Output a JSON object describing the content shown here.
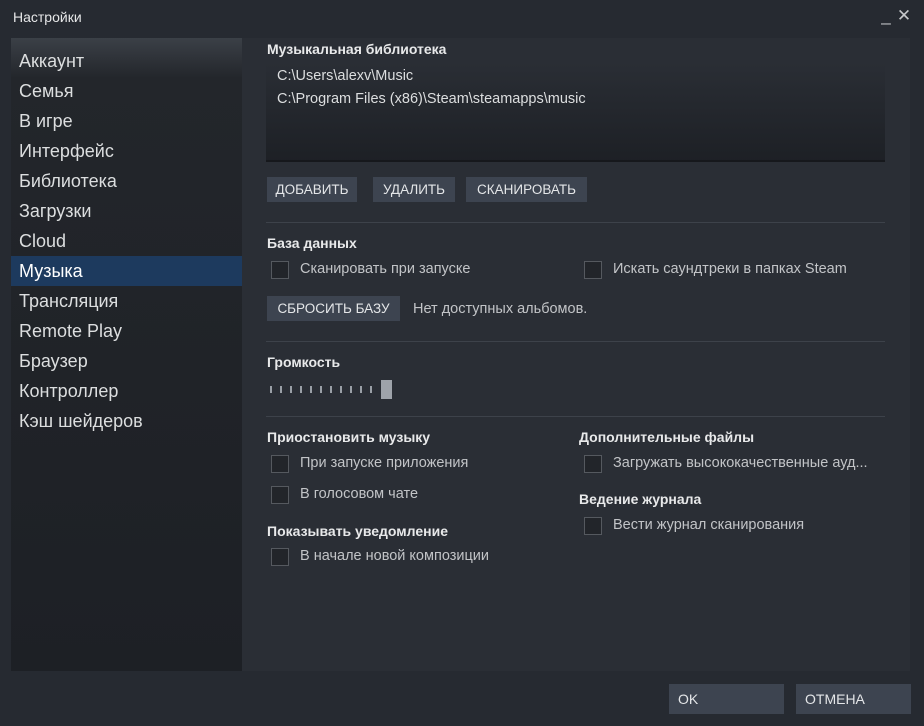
{
  "window": {
    "title": "Настройки",
    "minimize_glyph": "_",
    "close_glyph": "✕"
  },
  "sidebar": {
    "active_index": 7,
    "items": [
      {
        "label": "Аккаунт"
      },
      {
        "label": "Семья"
      },
      {
        "label": "В игре"
      },
      {
        "label": "Интерфейс"
      },
      {
        "label": "Библиотека"
      },
      {
        "label": "Загрузки"
      },
      {
        "label": "Cloud"
      },
      {
        "label": "Музыка"
      },
      {
        "label": "Трансляция"
      },
      {
        "label": "Remote Play"
      },
      {
        "label": "Браузер"
      },
      {
        "label": "Контроллер"
      },
      {
        "label": "Кэш шейдеров"
      }
    ]
  },
  "music_library": {
    "heading": "Музыкальная библиотека",
    "paths": [
      "C:\\Users\\alexv\\Music",
      "C:\\Program Files (x86)\\Steam\\steamapps\\music"
    ],
    "add_label": "ДОБАВИТЬ",
    "remove_label": "УДАЛИТЬ",
    "scan_label": "СКАНИРОВАТЬ"
  },
  "database": {
    "heading": "База данных",
    "scan_on_start": {
      "label": "Сканировать при запуске",
      "checked": false
    },
    "search_soundtracks": {
      "label": "Искать саундтреки в папках Steam",
      "checked": false
    },
    "reset_label": "СБРОСИТЬ БАЗУ",
    "status": "Нет доступных альбомов."
  },
  "volume": {
    "heading": "Громкость",
    "level": 1.0
  },
  "pause_music": {
    "heading": "Приостановить музыку",
    "on_app_launch": {
      "label": "При запуске приложения",
      "checked": false
    },
    "in_voice_chat": {
      "label": "В голосовом чате",
      "checked": false
    }
  },
  "show_notification": {
    "heading": "Показывать уведомление",
    "new_track": {
      "label": "В начале новой композиции",
      "checked": false
    }
  },
  "extra_files": {
    "heading": "Дополнительные файлы",
    "hq_audio": {
      "label": "Загружать высококачественные ауд...",
      "checked": false
    }
  },
  "logging": {
    "heading": "Ведение журнала",
    "scan_log": {
      "label": "Вести журнал сканирования",
      "checked": false
    }
  },
  "footer": {
    "ok_label": "OK",
    "cancel_label": "ОТМЕНА"
  },
  "colors": {
    "active_item": "#1d3a5e",
    "button_bg": "#3d4450",
    "window_bg": "#262a31"
  }
}
